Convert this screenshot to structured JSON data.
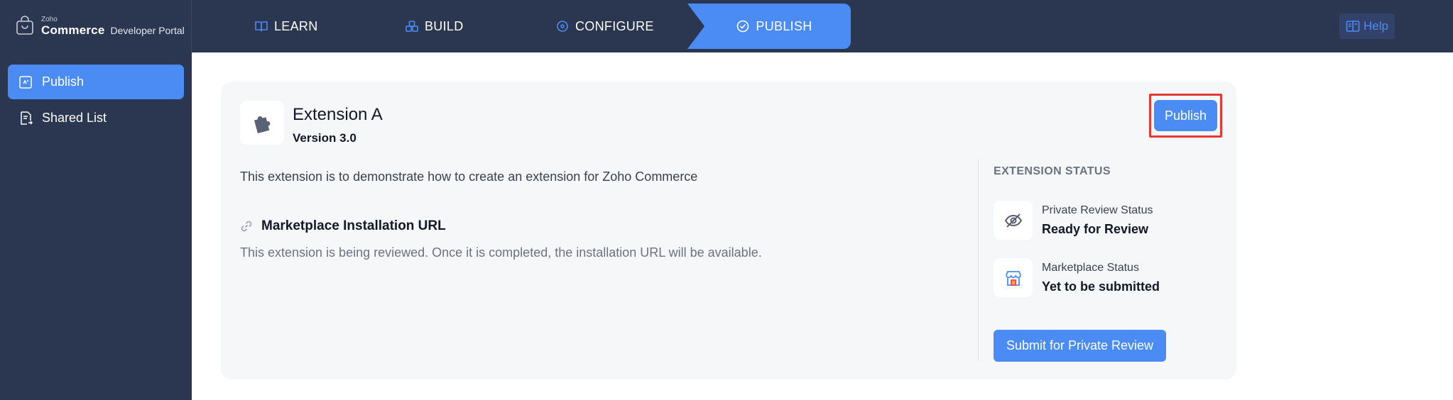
{
  "brand": {
    "zoho": "Zoho",
    "commerce": "Commerce",
    "portal": "Developer Portal"
  },
  "nav": {
    "tabs": [
      {
        "label": "LEARN",
        "icon": "book-icon"
      },
      {
        "label": "BUILD",
        "icon": "blocks-icon"
      },
      {
        "label": "CONFIGURE",
        "icon": "configure-icon"
      },
      {
        "label": "PUBLISH",
        "icon": "check-circle-icon",
        "active": true
      }
    ],
    "help_label": "Help"
  },
  "sidebar": {
    "items": [
      {
        "label": "Publish",
        "icon": "publish-doc-icon",
        "active": true
      },
      {
        "label": "Shared List",
        "icon": "shared-list-icon",
        "active": false
      }
    ]
  },
  "extension": {
    "name": "Extension A",
    "version": "Version 3.0",
    "description": "This extension is to demonstrate how to create an extension for Zoho Commerce",
    "publish_label": "Publish",
    "url_section": {
      "title": "Marketplace Installation URL",
      "note": "This extension is being reviewed. Once it is completed, the installation URL will be available."
    }
  },
  "status": {
    "heading": "EXTENSION STATUS",
    "private_review": {
      "label": "Private Review Status",
      "value": "Ready for Review"
    },
    "marketplace": {
      "label": "Marketplace Status",
      "value": "Yet to be submitted"
    },
    "submit_label": "Submit for Private Review"
  },
  "colors": {
    "topbar": "#2b3650",
    "accent": "#4a8cf4",
    "highlight_border": "#e53935"
  }
}
